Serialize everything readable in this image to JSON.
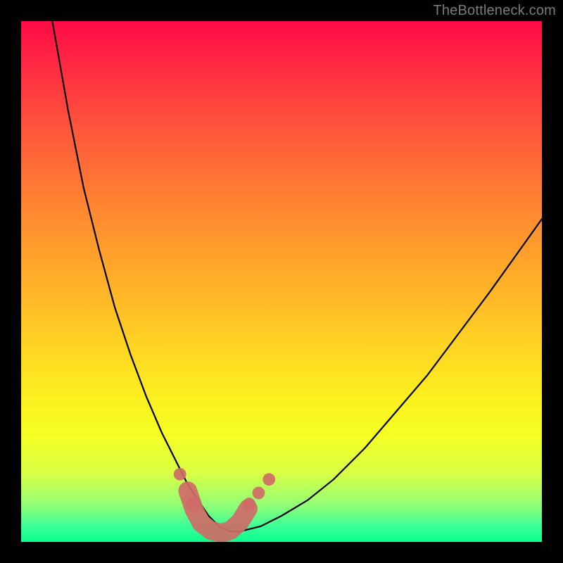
{
  "watermark_text": "TheBottleneck.com",
  "chart_data": {
    "type": "line",
    "title": "",
    "xlabel": "",
    "ylabel": "",
    "xlim": [
      0,
      100
    ],
    "ylim": [
      0,
      100
    ],
    "background_gradient_stops": [
      {
        "pct": 0,
        "color": "#ff0b46"
      },
      {
        "pct": 8,
        "color": "#ff2843"
      },
      {
        "pct": 22,
        "color": "#ff5a3b"
      },
      {
        "pct": 36,
        "color": "#ff8730"
      },
      {
        "pct": 50,
        "color": "#ffaf29"
      },
      {
        "pct": 62,
        "color": "#ffd323"
      },
      {
        "pct": 72,
        "color": "#fcef1f"
      },
      {
        "pct": 80,
        "color": "#f4ff25"
      },
      {
        "pct": 87,
        "color": "#d7ff46"
      },
      {
        "pct": 93,
        "color": "#91ff77"
      },
      {
        "pct": 97,
        "color": "#3aff96"
      },
      {
        "pct": 100,
        "color": "#0aff8f"
      }
    ],
    "series": [
      {
        "name": "bottleneck_curve",
        "color": "#000000",
        "x": [
          0,
          3,
          6,
          9,
          12,
          15,
          18,
          21,
          24,
          27,
          30,
          32,
          34,
          36,
          38,
          40,
          42,
          46,
          50,
          55,
          60,
          66,
          72,
          78,
          84,
          90,
          95,
          100
        ],
        "y": [
          145,
          120,
          100,
          83,
          68,
          56,
          45,
          36,
          28,
          21,
          15,
          11,
          8,
          5,
          3,
          2,
          2,
          3,
          5,
          8,
          12,
          18,
          25,
          32,
          40,
          48,
          55,
          62
        ]
      }
    ],
    "markers": [
      {
        "name": "marker-left-high",
        "x": 30.5,
        "y": 13.0,
        "r": 1.2,
        "color": "#cf6b67"
      },
      {
        "name": "marker-left-low",
        "x": 33.0,
        "y": 7.2,
        "r": 1.4,
        "color": "#cf6b67"
      },
      {
        "name": "marker-right-1",
        "x": 43.8,
        "y": 7.3,
        "r": 1.2,
        "color": "#cf6b67"
      },
      {
        "name": "marker-right-2",
        "x": 45.6,
        "y": 9.4,
        "r": 1.2,
        "color": "#cf6b67"
      },
      {
        "name": "marker-right-3",
        "x": 47.6,
        "y": 12.0,
        "r": 1.2,
        "color": "#cf6b67"
      }
    ],
    "trough_segment": {
      "color": "#cf6b67",
      "width": 3.6,
      "points": [
        {
          "x": 32.0,
          "y": 9.8
        },
        {
          "x": 33.2,
          "y": 6.2
        },
        {
          "x": 34.6,
          "y": 3.6
        },
        {
          "x": 36.4,
          "y": 2.2
        },
        {
          "x": 38.4,
          "y": 1.7
        },
        {
          "x": 40.2,
          "y": 2.2
        },
        {
          "x": 42.0,
          "y": 3.8
        },
        {
          "x": 43.6,
          "y": 6.4
        }
      ]
    }
  }
}
